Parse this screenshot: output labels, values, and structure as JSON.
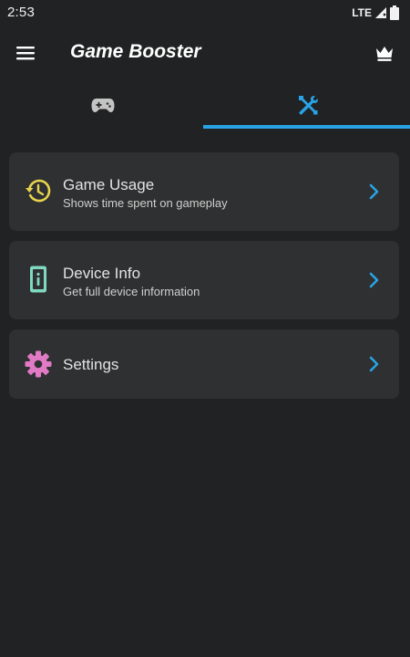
{
  "status_bar": {
    "time": "2:53",
    "network": "LTE"
  },
  "app_bar": {
    "title": "Game Booster"
  },
  "tabs": [
    {
      "name": "games",
      "icon": "gamepad-icon",
      "selected": false
    },
    {
      "name": "tools",
      "icon": "tools-icon",
      "selected": true
    }
  ],
  "cards": {
    "game_usage": {
      "title": "Game Usage",
      "subtitle": "Shows time spent on gameplay",
      "icon": "history-icon",
      "icon_color": "#e8d44d"
    },
    "device_info": {
      "title": "Device Info",
      "subtitle": "Get full device information",
      "icon": "device-info-icon",
      "icon_color": "#7fd8c0"
    },
    "settings": {
      "title": "Settings",
      "icon": "gear-icon",
      "icon_color": "#e07ac4"
    }
  },
  "colors": {
    "background": "#212223",
    "card": "#2f3031",
    "accent": "#29a3e6"
  }
}
